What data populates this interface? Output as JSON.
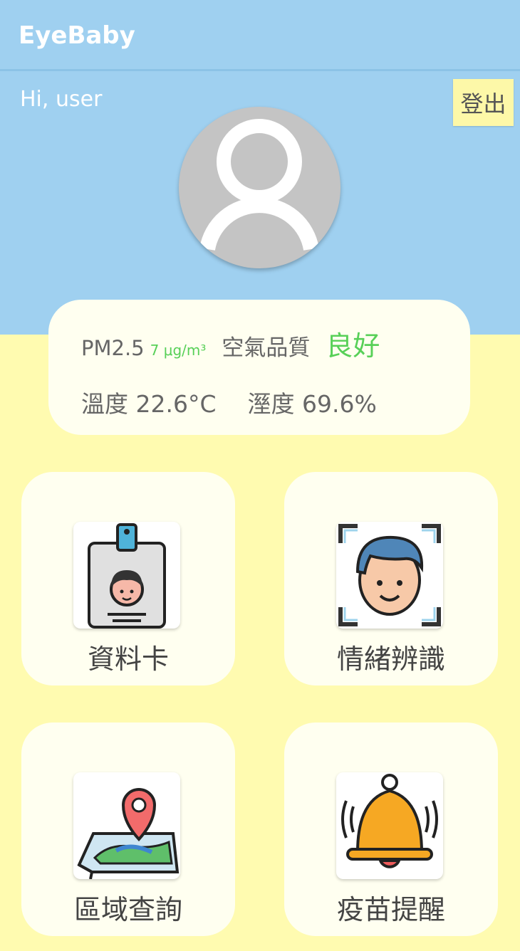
{
  "app": {
    "title": "EyeBaby"
  },
  "header": {
    "greeting": "Hi, user",
    "logout_label": "登出"
  },
  "environment": {
    "pm25_label": "PM2.5",
    "pm25_value": "7 μg/m³",
    "air_quality_label": "空氣品質",
    "air_quality_status": "良好",
    "temperature": "溫度 22.6°C",
    "humidity": "溼度 69.6%",
    "colors": {
      "good": "#58d058"
    }
  },
  "menu": [
    {
      "label": "資料卡",
      "icon": "id-card-icon"
    },
    {
      "label": "情緒辨識",
      "icon": "face-scan-icon"
    },
    {
      "label": "區域查詢",
      "icon": "map-pin-icon"
    },
    {
      "label": "疫苗提醒",
      "icon": "bell-icon"
    }
  ],
  "colors": {
    "top_bg": "#9fd0f0",
    "bottom_bg": "#fffbb0",
    "card_bg": "#fffff0"
  }
}
